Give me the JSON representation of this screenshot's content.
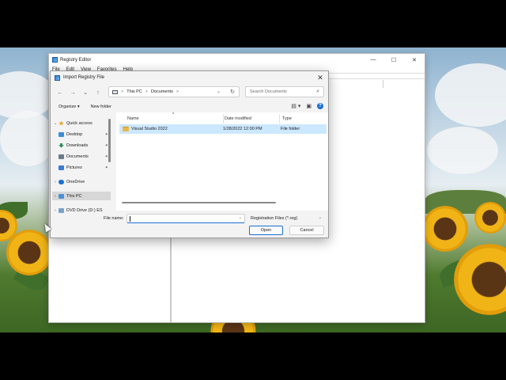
{
  "registry_window": {
    "title": "Registry Editor",
    "menu": [
      "File",
      "Edit",
      "View",
      "Favorites",
      "Help"
    ],
    "controls": {
      "minimize": "—",
      "maximize": "☐",
      "close": "✕"
    }
  },
  "dialog": {
    "title": "Import Registry File",
    "close": "✕",
    "nav": {
      "back": "←",
      "forward": "→",
      "recent": "⌄",
      "up": "↑"
    },
    "breadcrumb": [
      "This PC",
      "Documents"
    ],
    "breadcrumb_sep": ">",
    "refresh": "↻",
    "search_placeholder": "Search Documents",
    "search_icon": "⌕",
    "toolbar": {
      "organize": "Organize ▾",
      "new_folder": "New folder",
      "view_icon": "▤ ▾",
      "pane_icon": "▣",
      "help_icon": "?"
    },
    "nav_pane": [
      {
        "label": "Quick access",
        "icon": "star-icon",
        "color": "#e5a41e",
        "chev": "⌄",
        "pinned": false
      },
      {
        "label": "Desktop",
        "icon": "desktop-icon",
        "color": "#3a8fd9",
        "chev": "",
        "pinned": true
      },
      {
        "label": "Downloads",
        "icon": "download-icon",
        "color": "#2e8b57",
        "chev": "",
        "pinned": true
      },
      {
        "label": "Documents",
        "icon": "document-icon",
        "color": "#6b7b8c",
        "chev": "",
        "pinned": true
      },
      {
        "label": "Pictures",
        "icon": "pictures-icon",
        "color": "#3a7bd5",
        "chev": "",
        "pinned": true
      },
      {
        "label": "OneDrive",
        "icon": "cloud-icon",
        "color": "#1c6fd1",
        "chev": "›",
        "pinned": false
      },
      {
        "label": "This PC",
        "icon": "computer-icon",
        "color": "#4a90d9",
        "chev": "›",
        "pinned": false
      },
      {
        "label": "DVD Drive (D:) ES",
        "icon": "dvd-icon",
        "color": "#7aa2c9",
        "chev": "›",
        "pinned": false
      }
    ],
    "pin_glyph": "📌",
    "columns": {
      "name": "Name",
      "date_modified": "Date modified",
      "type": "Type",
      "sort_arrow": "^"
    },
    "files": [
      {
        "name": "Visual Studio 2022",
        "date": "1/28/2022 12:00 PM",
        "type": "File folder"
      }
    ],
    "file_name_label": "File name:",
    "file_name_value": "",
    "file_type": "Registration Files (*.reg)",
    "open_button": "Open",
    "cancel_button": "Cancel"
  },
  "colors": {
    "accent": "#1c6fd1",
    "selection": "#cce8ff"
  }
}
